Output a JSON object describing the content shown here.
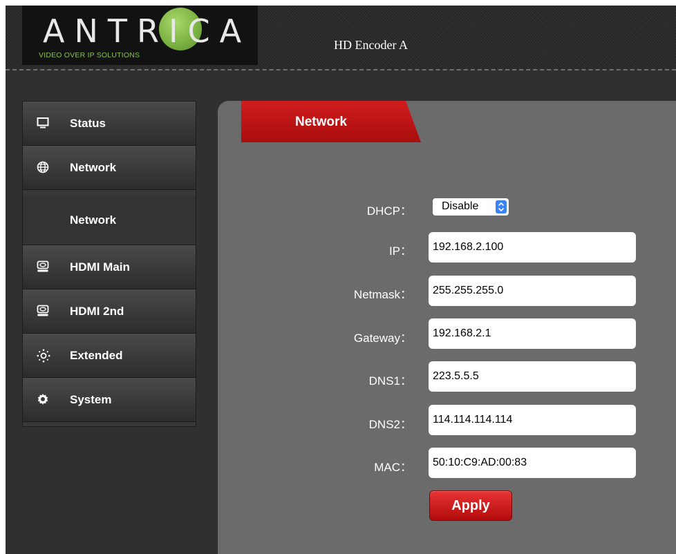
{
  "header": {
    "logo_text": "ANTRICA",
    "logo_tagline": "VIDEO OVER IP SOLUTIONS",
    "device_name": "HD Encoder  A"
  },
  "sidebar": {
    "items": [
      {
        "label": "Status",
        "icon": "monitor-icon"
      },
      {
        "label": "Network",
        "icon": "globe-icon"
      },
      {
        "label": "Network",
        "icon": ""
      },
      {
        "label": "HDMI Main",
        "icon": "hdmi-device-icon"
      },
      {
        "label": "HDMI 2nd",
        "icon": "hdmi-device-icon"
      },
      {
        "label": "Extended",
        "icon": "dotted-gear-icon"
      },
      {
        "label": "System",
        "icon": "gear-icon"
      }
    ]
  },
  "main": {
    "tab_label": "Network",
    "dhcp": {
      "label": "DHCP：",
      "value": "Disable"
    },
    "fields": {
      "ip": {
        "label": "IP：",
        "value": "192.168.2.100"
      },
      "netmask": {
        "label": "Netmask：",
        "value": "255.255.255.0"
      },
      "gateway": {
        "label": "Gateway：",
        "value": "192.168.2.1"
      },
      "dns1": {
        "label": "DNS1：",
        "value": "223.5.5.5"
      },
      "dns2": {
        "label": "DNS2：",
        "value": "114.114.114.114"
      },
      "mac": {
        "label": "MAC：",
        "value": "50:10:C9:AD:00:83"
      }
    },
    "apply_label": "Apply"
  },
  "colors": {
    "accent_red": "#c0151a",
    "logo_green": "#7cb342",
    "select_blue": "#3b82f6"
  }
}
